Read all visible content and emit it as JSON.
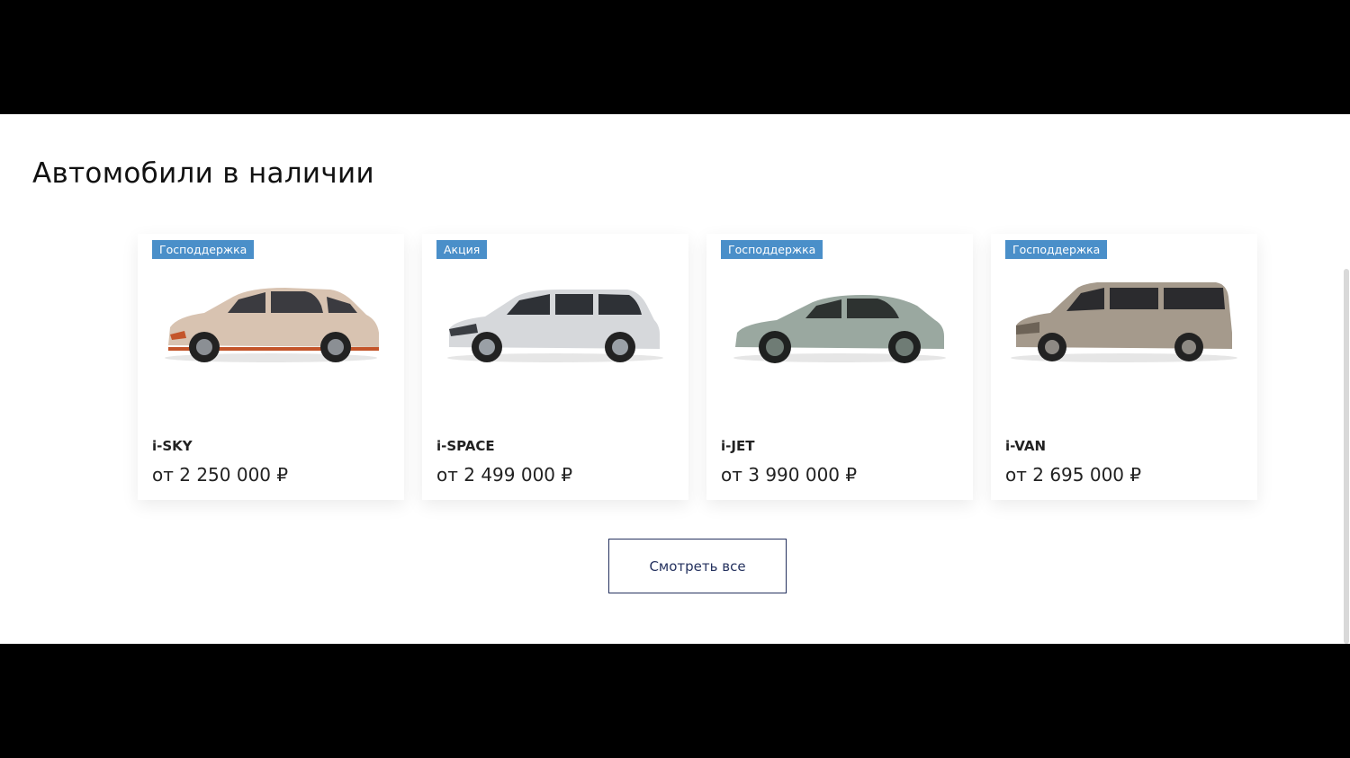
{
  "section": {
    "title": "Автомобили в наличии",
    "view_all_label": "Смотреть все"
  },
  "cars": [
    {
      "badge": "Господдержка",
      "name": "i-SKY",
      "price": "от 2 250 000 ₽",
      "body_color": "#d8c3b1",
      "accent": "#c4552a",
      "image": "crossover-icon"
    },
    {
      "badge": "Акция",
      "name": "i-SPACE",
      "price": "от 2 499 000 ₽",
      "body_color": "#d6d8db",
      "accent": "#9aa0a6",
      "image": "suv-icon"
    },
    {
      "badge": "Господдержка",
      "name": "i-JET",
      "price": "от 3 990 000 ₽",
      "body_color": "#9aa8a0",
      "accent": "#6f7c75",
      "image": "coupe-suv-icon"
    },
    {
      "badge": "Господдержка",
      "name": "i-VAN",
      "price": "от 2 695 000 ₽",
      "body_color": "#a59a8c",
      "accent": "#6d6357",
      "image": "minivan-icon"
    }
  ],
  "colors": {
    "badge": "#4a8fc9",
    "button_border": "#25325f",
    "background": "#ffffff"
  }
}
